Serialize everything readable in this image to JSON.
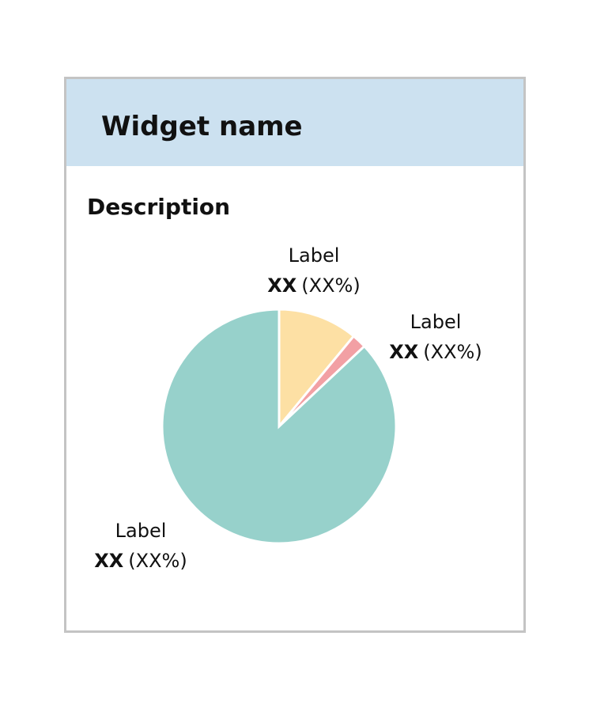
{
  "widget": {
    "title": "Widget name",
    "description": "Description",
    "colors": {
      "header_bg": "#cce1f0",
      "border": "#c4c4c4"
    }
  },
  "chart_data": {
    "type": "pie",
    "slices": [
      {
        "label": "Label",
        "value_text": "XX",
        "percent_text": "(XX%)",
        "share": 0.11,
        "color": "#fde0a4"
      },
      {
        "label": "Label",
        "value_text": "XX",
        "percent_text": "(XX%)",
        "share": 0.02,
        "color": "#f2a0a4"
      },
      {
        "label": "Label",
        "value_text": "XX",
        "percent_text": "(XX%)",
        "share": 0.87,
        "color": "#97d1cb"
      }
    ]
  }
}
